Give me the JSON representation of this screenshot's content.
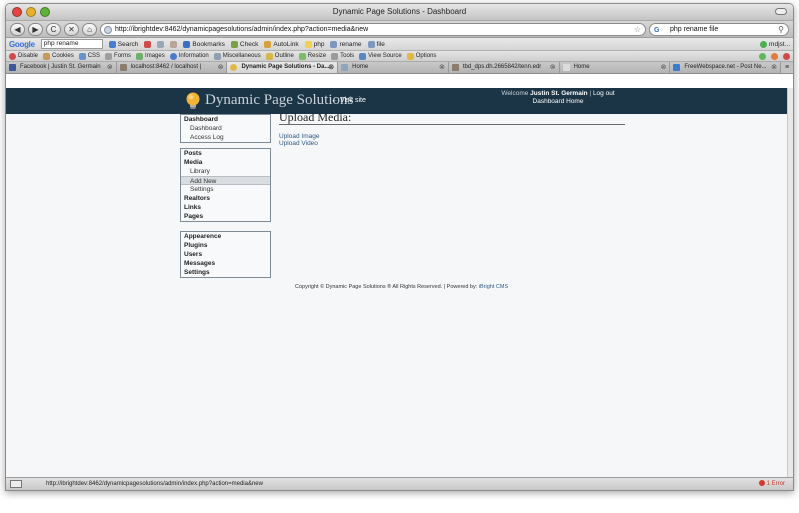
{
  "window": {
    "title": "Dynamic Page Solutions - Dashboard"
  },
  "nav": {
    "back": "◀",
    "forward": "▶",
    "reload": "C",
    "stop": "✕",
    "home": "⌂",
    "url": "http://ibrightdev:8462/dynamicpagesolutions/admin/index.php?action=media&new",
    "search_value": "php rename file"
  },
  "google_toolbar": {
    "logo": "Google",
    "search_value": "php rename",
    "items": [
      "Search",
      "",
      "",
      "",
      "Bookmarks",
      "",
      "Check",
      "AutoLink",
      "php",
      "rename",
      "file"
    ],
    "right_label": "mdjst..."
  },
  "webdev_toolbar": {
    "items": [
      "Disable",
      "Cookies",
      "CSS",
      "Forms",
      "Images",
      "Information",
      "Miscellaneous",
      "Outline",
      "Resize",
      "Tools",
      "View Source",
      "Options"
    ]
  },
  "tabs": [
    {
      "label": "Facebook | Justin St. Germain",
      "active": false
    },
    {
      "label": "localhost:8462 / localhost |",
      "active": false
    },
    {
      "label": "Dynamic Page Solutions - Da...",
      "active": true
    },
    {
      "label": "Home",
      "active": false
    },
    {
      "label": "tbd_dps.dh.2665842/tenn.edr",
      "active": false
    },
    {
      "label": "Home",
      "active": false
    },
    {
      "label": "FreeWebspace.net - Post Ne...",
      "active": false
    }
  ],
  "site": {
    "title": "Dynamic Page Solutions",
    "visit_site": "← Visit site",
    "welcome_prefix": "Welcome",
    "user_name": "Justin St. Germain",
    "separator": "|",
    "logout": "Log out",
    "dashboard_home": "Dashboard Home"
  },
  "sidebar": {
    "group1": [
      {
        "label": "Dashboard",
        "type": "head"
      },
      {
        "label": "Dashboard",
        "type": "sub"
      },
      {
        "label": "Access Log",
        "type": "sub"
      }
    ],
    "group2": [
      {
        "label": "Posts",
        "type": "head"
      },
      {
        "label": "Media",
        "type": "head"
      },
      {
        "label": "Library",
        "type": "sub"
      },
      {
        "label": "Add New",
        "type": "sub",
        "active": true
      },
      {
        "label": "Settings",
        "type": "sub"
      },
      {
        "label": "Realtors",
        "type": "head"
      },
      {
        "label": "Links",
        "type": "head"
      },
      {
        "label": "Pages",
        "type": "head"
      }
    ],
    "group3": [
      {
        "label": "Appearence",
        "type": "head"
      },
      {
        "label": "Plugins",
        "type": "head"
      },
      {
        "label": "Users",
        "type": "head"
      },
      {
        "label": "Messages",
        "type": "head"
      },
      {
        "label": "Settings",
        "type": "head"
      }
    ]
  },
  "content": {
    "title": "Upload Media:",
    "links": [
      "Upload Image",
      "Upload Video"
    ]
  },
  "footer": {
    "text": "Copyright © Dynamic Page Solutions ® All Rights Reserved. | Powered by:",
    "link": "iBright CMS"
  },
  "status": {
    "url": "http://ibrightdev:8462/dynamicpagesolutions/admin/index.php?action=media&new",
    "error": "1 Error"
  },
  "colors": {
    "header_bg": "#1c3546",
    "link": "#2f5a85",
    "page_bg": "#f5f7f9"
  }
}
